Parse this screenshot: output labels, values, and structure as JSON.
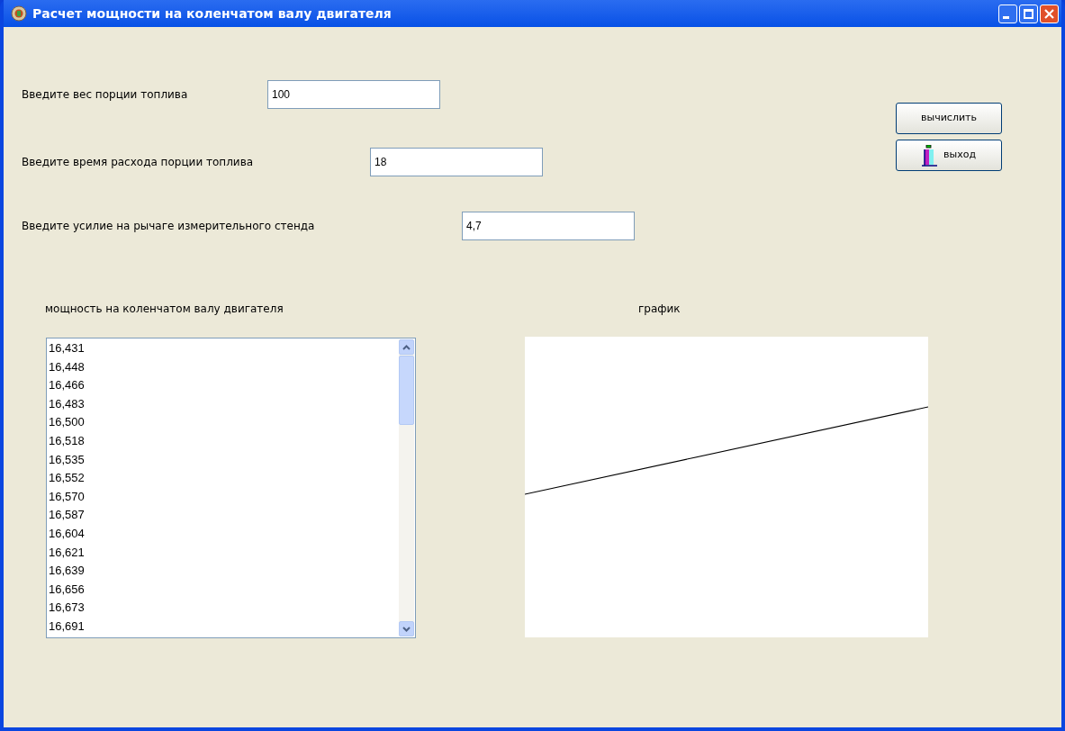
{
  "window": {
    "title": "Расчет мощности на коленчатом валу двигателя"
  },
  "fields": [
    {
      "label": "Введите вес порции топлива",
      "value": "100"
    },
    {
      "label": "Введите время расхода порции топлива",
      "value": "18"
    },
    {
      "label": "Введите усилие на рычаге измерительного стенда",
      "value": "4,7"
    }
  ],
  "buttons": [
    {
      "kind": "calc",
      "label": "вычислить"
    },
    {
      "kind": "exit",
      "label": "выход"
    }
  ],
  "results": {
    "label": "мощность на коленчатом валу двигателя",
    "items": [
      "16,431",
      "16,448",
      "16,466",
      "16,483",
      "16,500",
      "16,518",
      "16,535",
      "16,552",
      "16,570",
      "16,587",
      "16,604",
      "16,621",
      "16,639",
      "16,656",
      "16,673",
      "16,691"
    ]
  },
  "graph": {
    "label": "график"
  }
}
